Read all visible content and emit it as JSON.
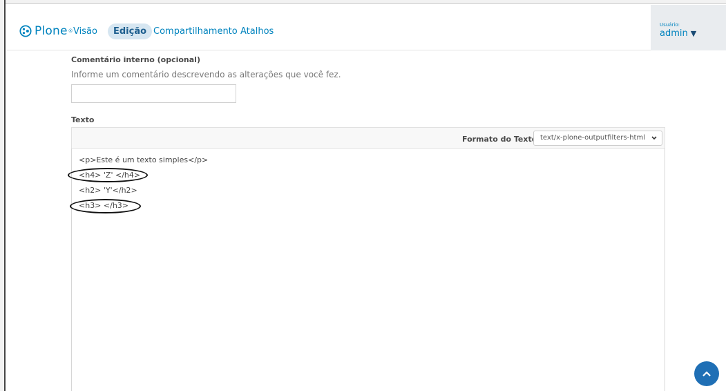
{
  "toolbar": {
    "logo_text": "Plone",
    "logo_reg": "®",
    "nav": [
      {
        "label": "Visão"
      },
      {
        "label": "Edição"
      },
      {
        "label": "Compartilhamento"
      },
      {
        "label": "Atalhos"
      }
    ],
    "active_nav": "Edição",
    "user_label": "Usuário:",
    "user_name": "admin",
    "user_caret": "▼"
  },
  "form": {
    "comment": {
      "label": "Comentário interno (opcional)",
      "help": "Informe um comentário descrevendo as alterações que você fez.",
      "value": ""
    },
    "text": {
      "label": "Texto",
      "format_label": "Formato do Texto",
      "format_value": "text/x-plone-outputfilters-html",
      "lines": [
        "<p>Este é um texto simples</p>",
        "<h4> 'Z' </h4>",
        "<h2> 'Y'</h2>",
        "<h3> </h3>"
      ]
    }
  },
  "colors": {
    "accent": "#0083be",
    "active_tab_bg": "#d6e6f1",
    "scroll_button": "#1f6fb5"
  },
  "icons": {
    "logo": "plone-logo-icon",
    "caret": "caret-down-icon",
    "select": "chevron-down-icon",
    "scroll": "chevron-up-icon"
  }
}
